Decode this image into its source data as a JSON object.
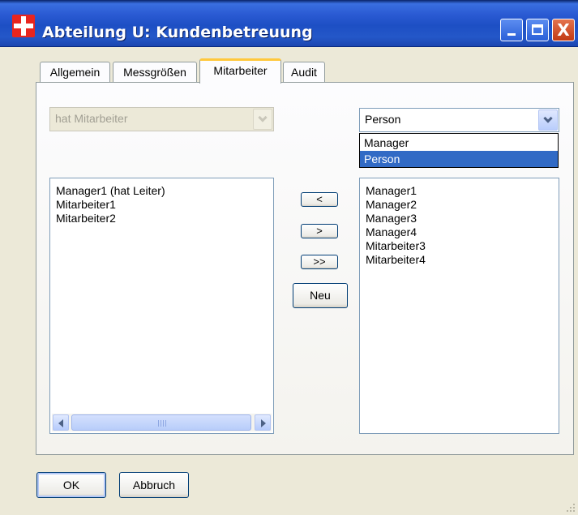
{
  "window": {
    "title": "Abteilung U: Kundenbetreuung",
    "close_glyph": "X"
  },
  "tabs": [
    {
      "label": "Allgemein",
      "active": false
    },
    {
      "label": "Messgrößen",
      "active": false
    },
    {
      "label": "Mitarbeiter",
      "active": true
    },
    {
      "label": "Audit",
      "active": false
    }
  ],
  "left_combo": {
    "value": "hat Mitarbeiter",
    "disabled": true
  },
  "right_combo": {
    "value": "Person",
    "options": [
      "Manager",
      "Person"
    ],
    "selected_option": "Person"
  },
  "left_list": {
    "items": [
      "Manager1 (hat Leiter)",
      "Mitarbeiter1",
      "Mitarbeiter2"
    ]
  },
  "right_list": {
    "items": [
      "Manager1",
      "Manager2",
      "Manager3",
      "Manager4",
      "Mitarbeiter3",
      "Mitarbeiter4"
    ]
  },
  "transfer_buttons": {
    "move_left": "<",
    "move_right": ">",
    "move_all_right": ">>",
    "new": "Neu"
  },
  "footer": {
    "ok": "OK",
    "cancel": "Abbruch"
  },
  "icons": {
    "app": "red-cross-icon",
    "scroll_left": "arrow-left-icon",
    "scroll_right": "arrow-right-icon",
    "combo_arrow": "chevron-down-icon"
  },
  "colors": {
    "titlebar": "#2b5bd4",
    "app_icon": "#e8251f",
    "selection": "#316ac5",
    "active_tab_accent": "#ffc83c"
  }
}
